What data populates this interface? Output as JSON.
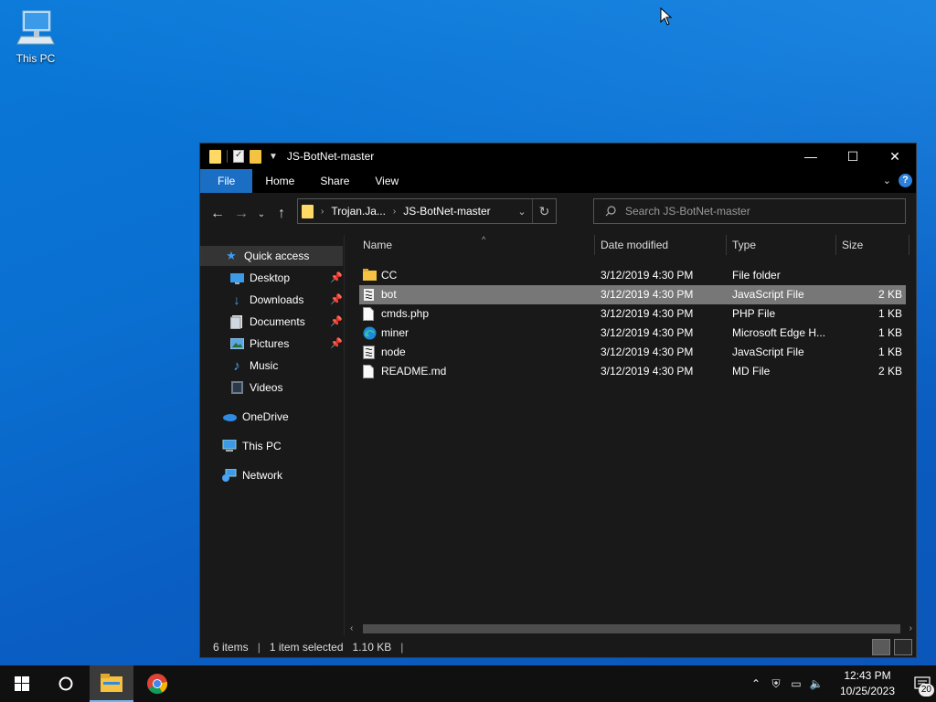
{
  "desktop": {
    "icons": [
      {
        "label": "This PC"
      }
    ]
  },
  "window": {
    "title": "JS-BotNet-master",
    "ribbon_tabs": [
      "File",
      "Home",
      "Share",
      "View"
    ],
    "address": {
      "crumbs": [
        "Trojan.Ja...",
        "JS-BotNet-master"
      ]
    },
    "search": {
      "placeholder": "Search JS-BotNet-master"
    },
    "sidebar": {
      "quick_access": "Quick access",
      "items": [
        {
          "label": "Desktop",
          "icon": "desktop-icon",
          "pinned": true
        },
        {
          "label": "Downloads",
          "icon": "download-arrow-icon",
          "pinned": true
        },
        {
          "label": "Documents",
          "icon": "documents-icon",
          "pinned": true
        },
        {
          "label": "Pictures",
          "icon": "pictures-icon",
          "pinned": true
        },
        {
          "label": "Music",
          "icon": "music-note-icon",
          "pinned": false
        },
        {
          "label": "Videos",
          "icon": "videos-icon",
          "pinned": false
        }
      ],
      "onedrive": "OneDrive",
      "this_pc": "This PC",
      "network": "Network"
    },
    "columns": {
      "name": "Name",
      "date": "Date modified",
      "type": "Type",
      "size": "Size"
    },
    "files": [
      {
        "name": "CC",
        "date": "3/12/2019 4:30 PM",
        "type": "File folder",
        "size": "",
        "icon": "folder-icon",
        "selected": false
      },
      {
        "name": "bot",
        "date": "3/12/2019 4:30 PM",
        "type": "JavaScript File",
        "size": "2 KB",
        "icon": "script-file-icon",
        "selected": true
      },
      {
        "name": "cmds.php",
        "date": "3/12/2019 4:30 PM",
        "type": "PHP File",
        "size": "1 KB",
        "icon": "blank-file-icon",
        "selected": false
      },
      {
        "name": "miner",
        "date": "3/12/2019 4:30 PM",
        "type": "Microsoft Edge H...",
        "size": "1 KB",
        "icon": "edge-icon",
        "selected": false
      },
      {
        "name": "node",
        "date": "3/12/2019 4:30 PM",
        "type": "JavaScript File",
        "size": "1 KB",
        "icon": "script-file-icon",
        "selected": false
      },
      {
        "name": "README.md",
        "date": "3/12/2019 4:30 PM",
        "type": "MD File",
        "size": "2 KB",
        "icon": "blank-file-icon",
        "selected": false
      }
    ],
    "status": {
      "count": "6 items",
      "selected": "1 item selected",
      "size": "1.10 KB"
    }
  },
  "taskbar": {
    "clock_time": "12:43 PM",
    "clock_date": "10/25/2023",
    "notification_count": "20"
  },
  "colors": {
    "accent": "#1a6fc4",
    "selection": "#777777",
    "window_bg": "#191919"
  }
}
